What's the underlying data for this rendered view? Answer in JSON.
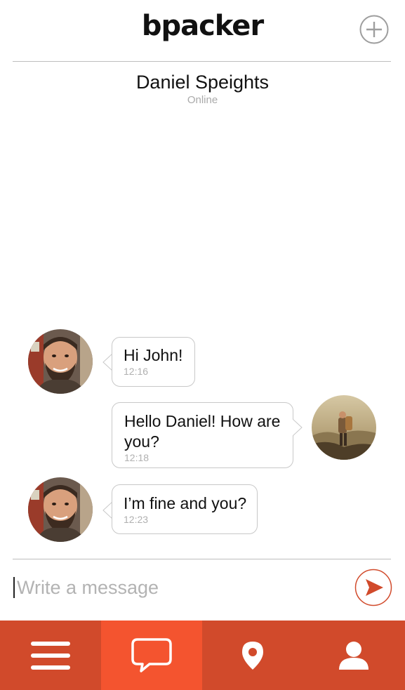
{
  "header": {
    "brand": "bpacker",
    "add_icon": "plus-circle-icon"
  },
  "conversation": {
    "contact_name": "Daniel Speights",
    "contact_status": "Online",
    "messages": [
      {
        "from": "contact",
        "text": "Hi John!",
        "time": "12:16"
      },
      {
        "from": "me",
        "text_line1": "Hello Daniel! How are",
        "text_line2": "you?",
        "time": "12:18"
      },
      {
        "from": "contact",
        "text": "I’m fine and you?",
        "time": "12:23"
      }
    ]
  },
  "composer": {
    "placeholder": "Write a message",
    "send_icon": "send-arrow-icon"
  },
  "tab_bar": {
    "tabs": [
      {
        "icon": "menu-icon",
        "active": false
      },
      {
        "icon": "chat-bubble-icon",
        "active": true
      },
      {
        "icon": "map-pin-icon",
        "active": false
      },
      {
        "icon": "user-icon",
        "active": false
      }
    ]
  },
  "colors": {
    "accent": "#d14a2b",
    "accent_active": "#f4542f",
    "divider": "#bdbdbd",
    "muted_text": "#b0b0b0"
  }
}
